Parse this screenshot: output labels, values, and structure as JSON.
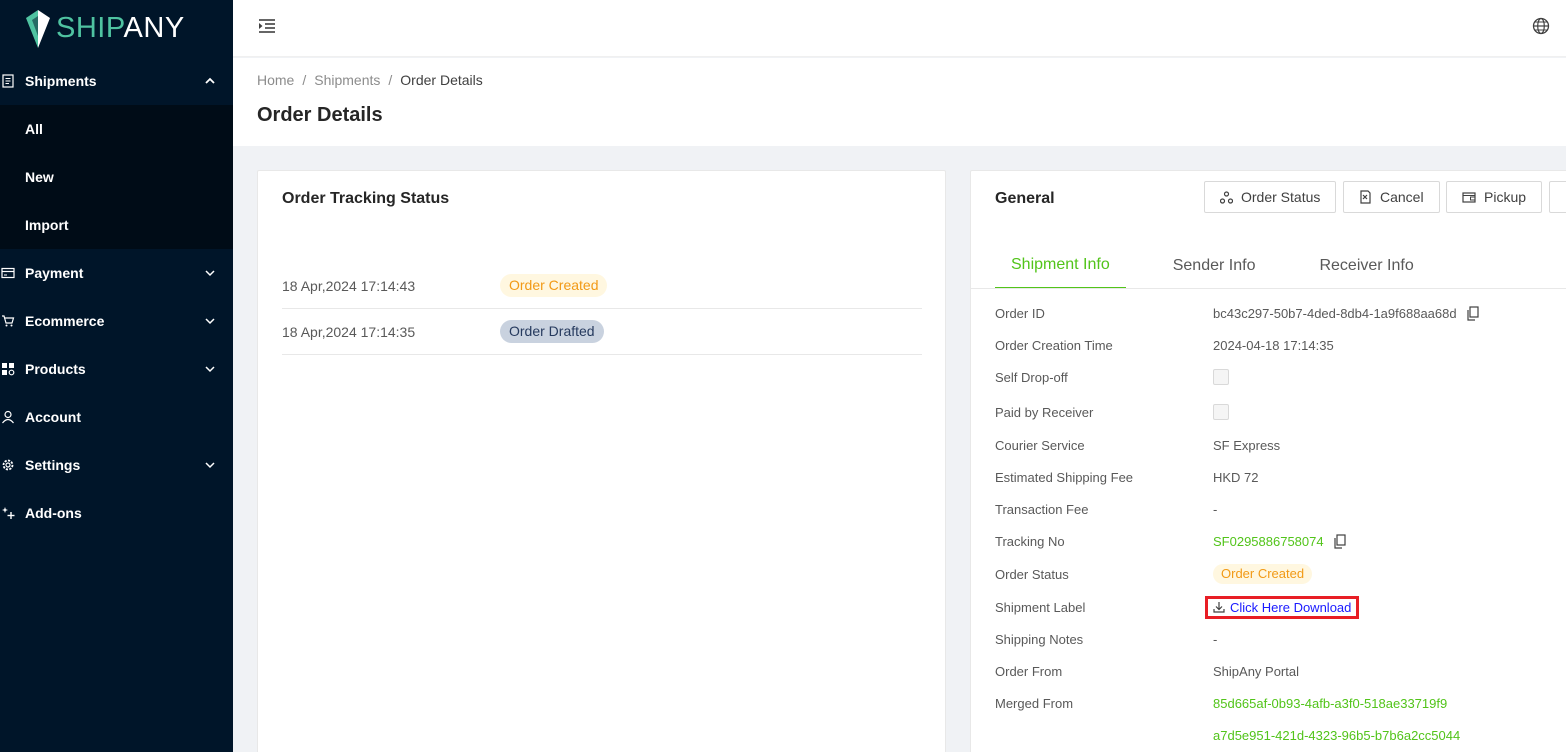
{
  "brand": {
    "ship": "SHIP",
    "any": "ANY"
  },
  "sidebar": {
    "items": [
      {
        "label": "Shipments",
        "icon": "file-list-icon",
        "expanded": true
      },
      {
        "label": "Payment",
        "icon": "credit-card-icon"
      },
      {
        "label": "Ecommerce",
        "icon": "cart-icon"
      },
      {
        "label": "Products",
        "icon": "apps-icon"
      },
      {
        "label": "Account",
        "icon": "user-icon"
      },
      {
        "label": "Settings",
        "icon": "gear-icon"
      },
      {
        "label": "Add-ons",
        "icon": "sparkle-icon"
      }
    ],
    "sub_items": [
      "All",
      "New",
      "Import"
    ]
  },
  "breadcrumb": {
    "home": "Home",
    "shipments": "Shipments",
    "current": "Order Details",
    "sep": "/"
  },
  "page": {
    "title": "Order Details"
  },
  "tracking": {
    "title": "Order Tracking Status",
    "rows": [
      {
        "time": "18 Apr,2024 17:14:43",
        "status": "Order Created"
      },
      {
        "time": "18 Apr,2024 17:14:35",
        "status": "Order Drafted"
      }
    ]
  },
  "general": {
    "title": "General",
    "buttons": {
      "order_status": "Order Status",
      "cancel": "Cancel",
      "pickup": "Pickup"
    },
    "tabs": [
      "Shipment Info",
      "Sender Info",
      "Receiver Info"
    ],
    "active_tab": "Shipment Info",
    "labels": {
      "order_id": "Order ID",
      "order_creation_time": "Order Creation Time",
      "self_dropoff": "Self Drop-off",
      "paid_by_receiver": "Paid by Receiver",
      "courier_service": "Courier Service",
      "estimated_fee": "Estimated Shipping Fee",
      "transaction_fee": "Transaction Fee",
      "tracking_no": "Tracking No",
      "order_status": "Order Status",
      "shipment_label": "Shipment Label",
      "shipping_notes": "Shipping Notes",
      "order_from": "Order From",
      "merged_from": "Merged From"
    },
    "values": {
      "order_id": "bc43c297-50b7-4ded-8db4-1a9f688aa68d",
      "order_creation_time": "2024-04-18 17:14:35",
      "self_dropoff": false,
      "paid_by_receiver": false,
      "courier_service": "SF Express",
      "estimated_fee": "HKD 72",
      "transaction_fee": "-",
      "tracking_no": "SF0295886758074",
      "order_status": "Order Created",
      "shipment_label_link": "Click Here Download",
      "shipping_notes": "-",
      "order_from": "ShipAny Portal",
      "merged_from_1": "85d665af-0b93-4afb-a3f0-518ae33719f9",
      "merged_from_2": "a7d5e951-421d-4323-96b5-b7b6a2cc5044"
    }
  },
  "colors": {
    "sidebar_bg": "#001529",
    "submenu_bg": "#000c17",
    "accent_green": "#52c41a",
    "brand_teal": "#4fc3a1",
    "highlight_red": "#e81e25",
    "link_blue": "#1a1aff"
  }
}
